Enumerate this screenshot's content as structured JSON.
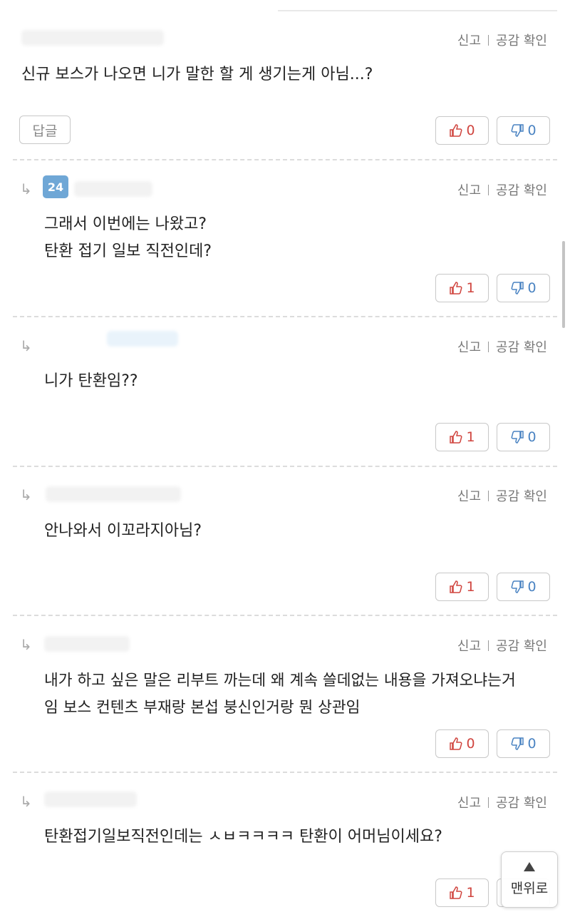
{
  "labels": {
    "report": "신고",
    "empathy": "공감 확인",
    "reply": "답글",
    "top": "맨위로"
  },
  "comments": [
    {
      "text": "신규 보스가 나오면 니가 말한 할 게 생기는게 아님...?",
      "up": "0",
      "down": "0",
      "badge": ""
    },
    {
      "text": "그래서 이번에는 나왔고?\n탄환 접기 일보 직전인데?",
      "up": "1",
      "down": "0",
      "badge": "24"
    },
    {
      "text": "니가 탄환임??",
      "up": "1",
      "down": "0",
      "badge": ""
    },
    {
      "text": "안나와서 이꼬라지아님?",
      "up": "1",
      "down": "0",
      "badge": ""
    },
    {
      "text": "내가 하고 싶은 말은 리부트 까는데 왜 계속 쓸데없는 내용을 가져오냐는거\n임 보스 컨텐츠 부재랑 본섭 붕신인거랑 뭔 상관임",
      "up": "0",
      "down": "0",
      "badge": ""
    },
    {
      "text": "탄환접기일보직전인데는 ㅅㅂㅋㅋㅋㅋ 탄환이 어머님이세요?",
      "up": "1",
      "down": "",
      "badge": ""
    }
  ]
}
